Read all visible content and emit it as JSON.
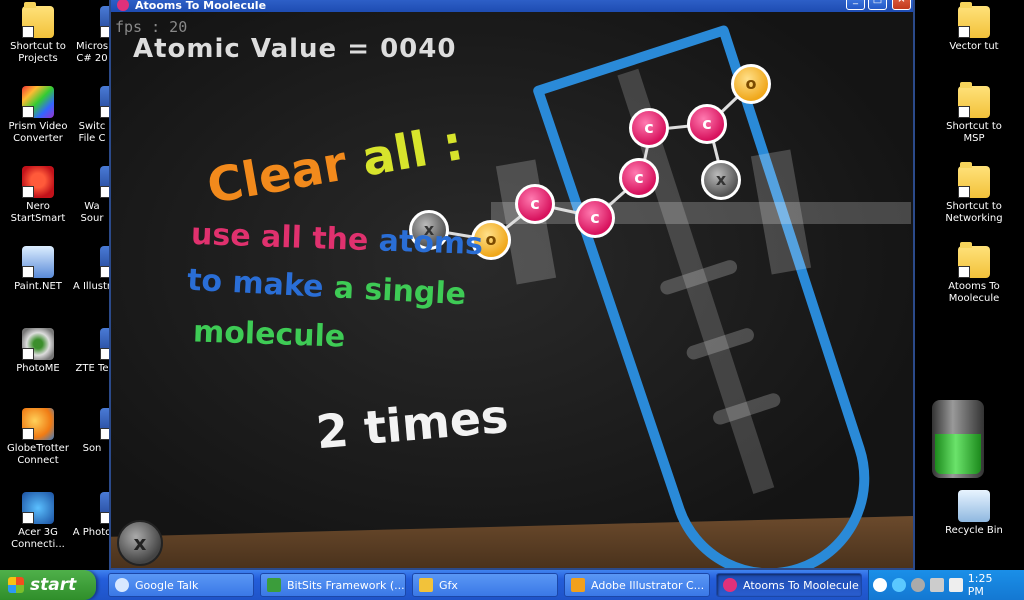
{
  "window": {
    "title": "Atooms To Moolecule"
  },
  "game": {
    "fps": "fps : 20",
    "atomic_value": "Atomic Value = 0040",
    "clear_all_1": "Clear",
    "clear_all_2": "all :",
    "line1_a": "use all the ",
    "line1_b": "atoms",
    "line2_a": "to make ",
    "line2_b": "a single",
    "line3": "molecule",
    "times": "2 times",
    "atom_c_label": "c",
    "atom_o_label": "o",
    "atom_x_label": "x",
    "clear_button_label": "x"
  },
  "desktop": {
    "left_icons": [
      {
        "label": "Shortcut to Projects",
        "icon": "folder-icon"
      },
      {
        "label": "Prism Video Converter",
        "icon": "prism-icon"
      },
      {
        "label": "Nero StartSmart",
        "icon": "nero-icon"
      },
      {
        "label": "Paint.NET",
        "icon": "paint-icon"
      },
      {
        "label": "PhotoME",
        "icon": "eye-icon"
      },
      {
        "label": "GlobeTrotter Connect",
        "icon": "globe-icon"
      },
      {
        "label": "Acer 3G Connecti...",
        "icon": "acer-icon"
      }
    ],
    "partial_icons": [
      {
        "label": "Micros C# 20"
      },
      {
        "label": "Switc File C"
      },
      {
        "label": "Wa Sour"
      },
      {
        "label": "A Illustr"
      },
      {
        "label": "ZTE Te"
      },
      {
        "label": "Son"
      },
      {
        "label": "A Photo"
      }
    ],
    "right_icons": [
      {
        "label": "Vector tut",
        "icon": "folder-icon"
      },
      {
        "label": "Shortcut to MSP",
        "icon": "folder-icon"
      },
      {
        "label": "Shortcut to Networking",
        "icon": "folder-icon"
      },
      {
        "label": "Atooms To Moolecule",
        "icon": "folder-icon"
      },
      {
        "label": "Recycle Bin",
        "icon": "recycle-icon"
      }
    ]
  },
  "taskbar": {
    "start": "start",
    "tasks": [
      {
        "label": "Google Talk"
      },
      {
        "label": "BitSits Framework (..."
      },
      {
        "label": "Gfx"
      },
      {
        "label": "Adobe Illustrator C..."
      },
      {
        "label": "Atooms To Moolecule"
      }
    ],
    "clock": "1:25 PM"
  },
  "colors": {
    "atom_c": "#d8135e",
    "atom_o": "#f0a81c",
    "atom_x": "#555555",
    "tube": "#2a8ad8"
  }
}
